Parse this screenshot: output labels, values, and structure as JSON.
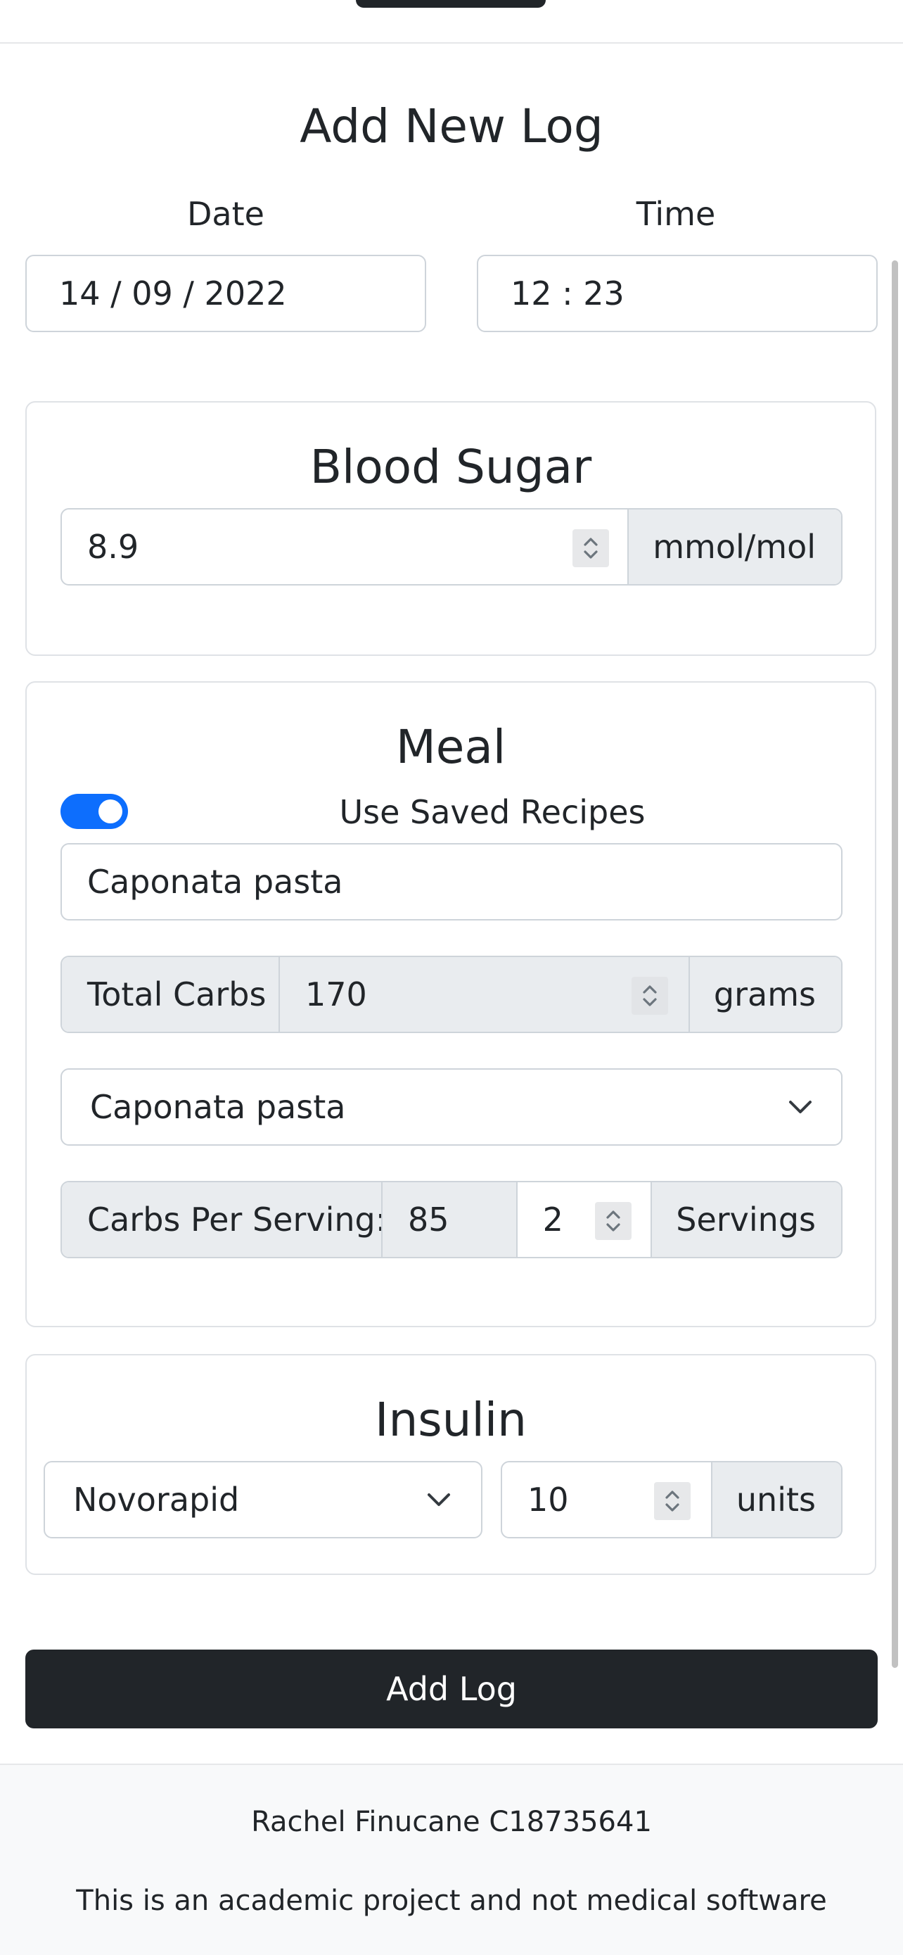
{
  "header": {
    "title": "Add New Log"
  },
  "datetime": {
    "date_label": "Date",
    "date_value": "14 / 09 / 2022",
    "time_label": "Time",
    "time_value": "12 : 23"
  },
  "blood_sugar": {
    "title": "Blood Sugar",
    "value": "8.9",
    "unit": "mmol/mol"
  },
  "meal": {
    "title": "Meal",
    "toggle_label": "Use Saved Recipes",
    "toggle_on": true,
    "recipe_name": "Caponata pasta",
    "total_carbs_label": "Total Carbs",
    "total_carbs_value": "170",
    "total_carbs_unit": "grams",
    "recipe_select_value": "Caponata pasta",
    "carbs_per_serving_label": "Carbs Per Serving:",
    "carbs_per_serving_value": "85",
    "servings_value": "2",
    "servings_unit": "Servings"
  },
  "insulin": {
    "title": "Insulin",
    "type_value": "Novorapid",
    "dose_value": "10",
    "dose_unit": "units"
  },
  "actions": {
    "submit_label": "Add Log"
  },
  "footer": {
    "author": "Rachel Finucane C18735641",
    "disclaimer": "This is an academic project and not medical software"
  },
  "colors": {
    "accent": "#0d6efd",
    "dark": "#212529",
    "addon_bg": "#e9ecef",
    "border": "#ced4da"
  }
}
